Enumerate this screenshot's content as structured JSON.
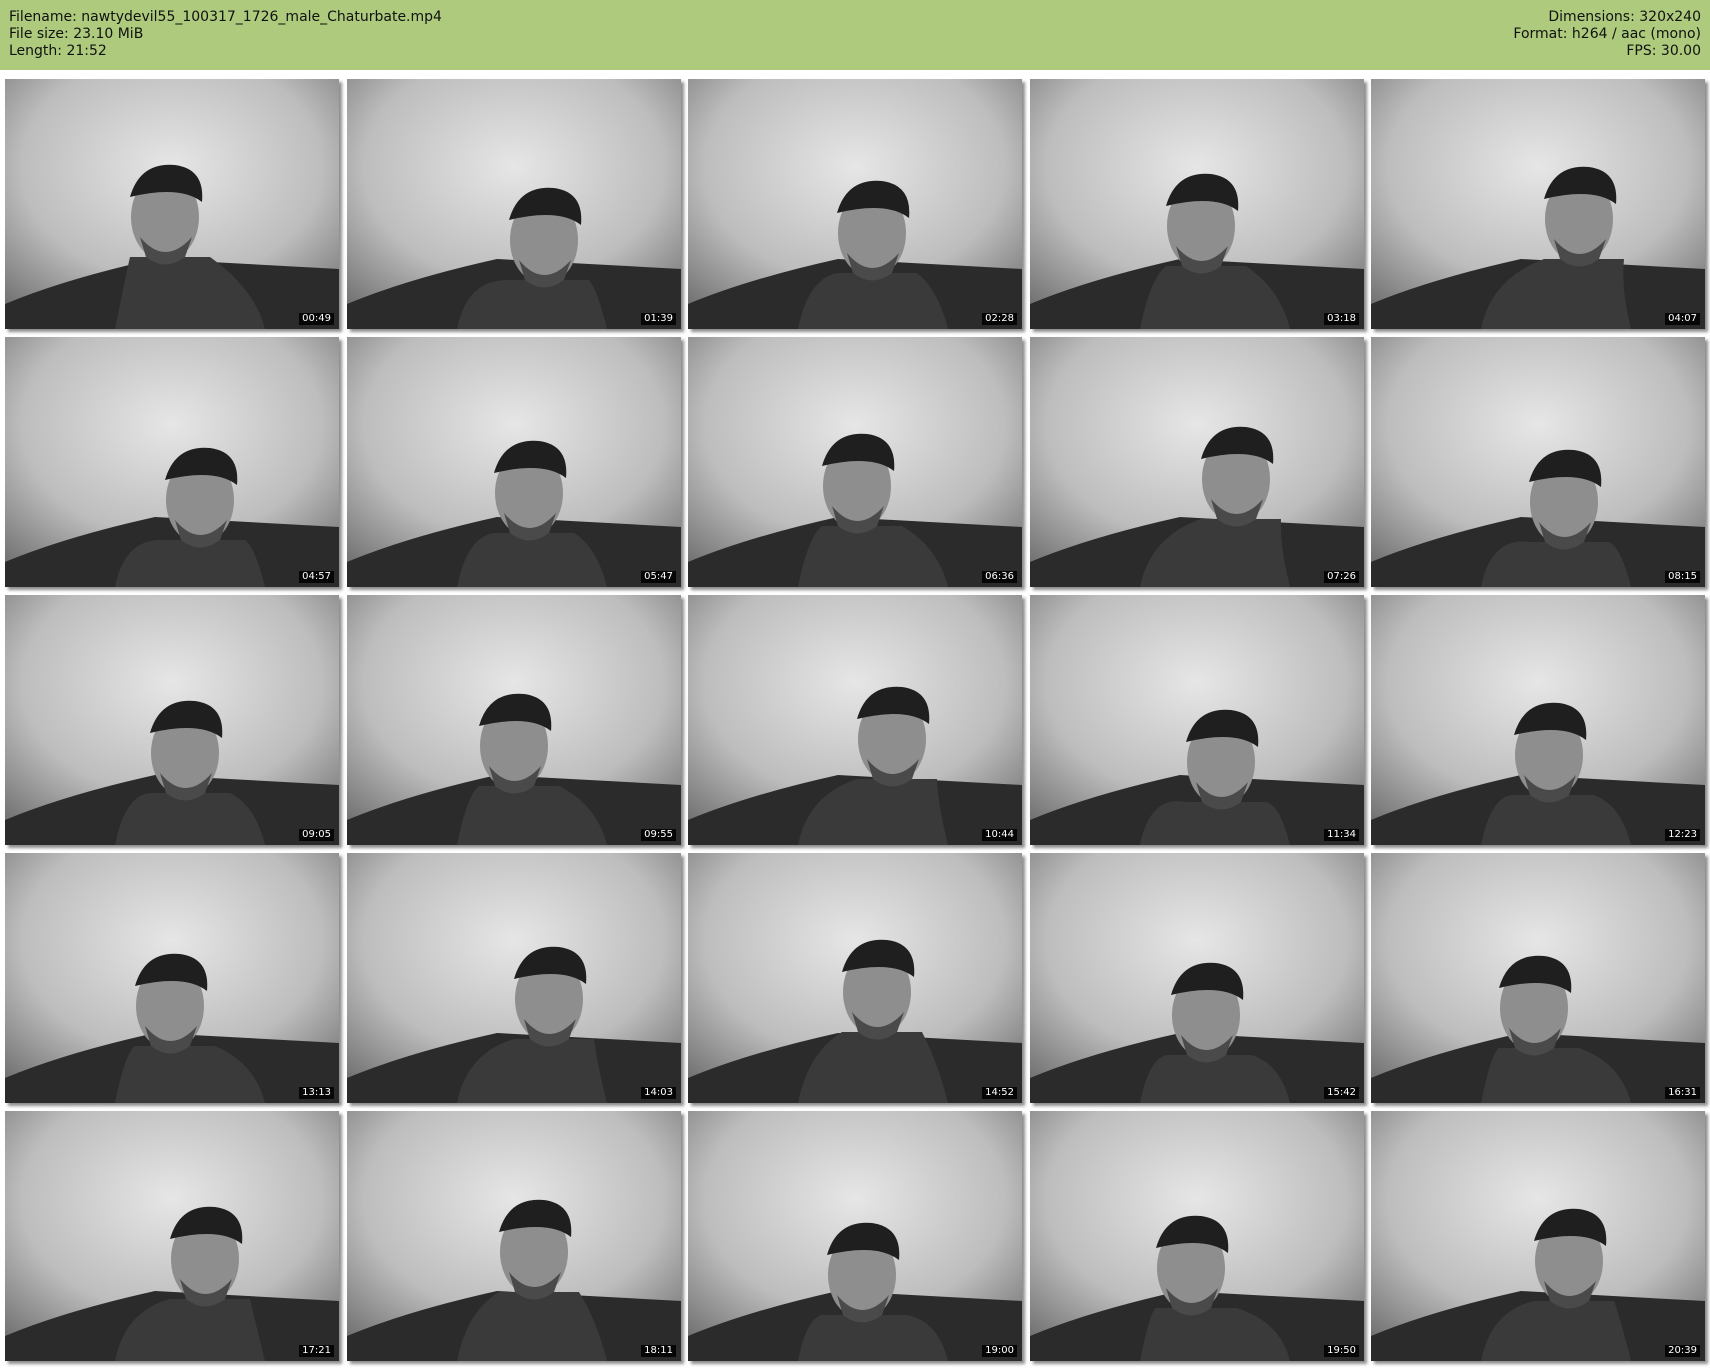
{
  "header": {
    "filename_line": "Filename: nawtydevil55_100317_1726_male_Chaturbate.mp4",
    "filesize_line": "File size: 23.10 MiB",
    "length_line": "Length: 21:52",
    "dimensions_line": "Dimensions: 320x240",
    "format_line": "Format: h264 / aac (mono)",
    "fps_line": "FPS: 30.00"
  },
  "colors": {
    "header_background": "#aecb7d",
    "frame_wall": "#c9c9c9",
    "frame_dark": "#2a2a2a"
  },
  "thumbnails": [
    {
      "timestamp": "00:49"
    },
    {
      "timestamp": "01:39"
    },
    {
      "timestamp": "02:28"
    },
    {
      "timestamp": "03:18"
    },
    {
      "timestamp": "04:07"
    },
    {
      "timestamp": "04:57"
    },
    {
      "timestamp": "05:47"
    },
    {
      "timestamp": "06:36"
    },
    {
      "timestamp": "07:26"
    },
    {
      "timestamp": "08:15"
    },
    {
      "timestamp": "09:05"
    },
    {
      "timestamp": "09:55"
    },
    {
      "timestamp": "10:44"
    },
    {
      "timestamp": "11:34"
    },
    {
      "timestamp": "12:23"
    },
    {
      "timestamp": "13:13"
    },
    {
      "timestamp": "14:03"
    },
    {
      "timestamp": "14:52"
    },
    {
      "timestamp": "15:42"
    },
    {
      "timestamp": "16:31"
    },
    {
      "timestamp": "17:21"
    },
    {
      "timestamp": "18:11"
    },
    {
      "timestamp": "19:00"
    },
    {
      "timestamp": "19:50"
    },
    {
      "timestamp": "20:39"
    }
  ]
}
